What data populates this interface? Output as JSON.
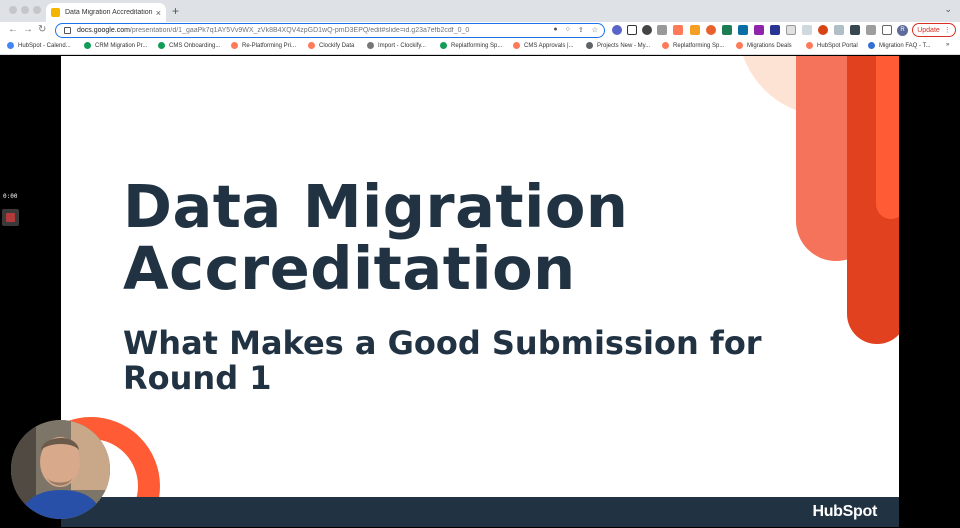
{
  "browser": {
    "tab_title": "Data Migration Accreditation |",
    "tab_close": "×",
    "new_tab": "+",
    "tab_menu": "⌄",
    "nav": {
      "back": "←",
      "forward": "→",
      "reload": "↻"
    },
    "url_host": "docs.google.com",
    "url_path": "/presentation/d/1_gaaPk7q1AY5Vv9WX_zVk8B4XQV4zpGD1wQ-pmD3EPQ/edit#slide=id.g23a7efb2cdf_0_0",
    "profile_initial": "R",
    "update_label": "Update",
    "update_menu": "⋮"
  },
  "bookmarks": [
    {
      "label": "HubSpot - Calend...",
      "color": "#4285f4"
    },
    {
      "label": "CRM Migration Pr...",
      "color": "#0f9d58"
    },
    {
      "label": "CMS Onboarding...",
      "color": "#0f9d58"
    },
    {
      "label": "Re-Platforming Pri...",
      "color": "#ff7a59"
    },
    {
      "label": "Clockify Data",
      "color": "#ff7a59"
    },
    {
      "label": "Import - Clockify...",
      "color": "#777777"
    },
    {
      "label": "Replatforming Sp...",
      "color": "#0f9d58"
    },
    {
      "label": "CMS Approvals |...",
      "color": "#ff7a59"
    },
    {
      "label": "Projects New - My...",
      "color": "#5f6368"
    },
    {
      "label": "Replatforming Sp...",
      "color": "#ff7a59"
    },
    {
      "label": "Migrations Deals",
      "color": "#ff7a59"
    },
    {
      "label": "HubSpot Portal",
      "color": "#ff7a59"
    },
    {
      "label": "Migration FAQ - T...",
      "color": "#2f6fd6"
    }
  ],
  "bookmarks_overflow": "»",
  "slide": {
    "title_line1": "Data Migration",
    "title_line2": "Accreditation",
    "subtitle_line1": "What Makes a Good Submission for",
    "subtitle_line2": "Round 1",
    "logo": "HubSpot"
  },
  "recording": {
    "timer": "0:00"
  },
  "colors": {
    "navy": "#213343",
    "orange": "#ff5c35",
    "coral": "#f5735a",
    "red": "#e1411f",
    "peach": "#fde3d3"
  }
}
